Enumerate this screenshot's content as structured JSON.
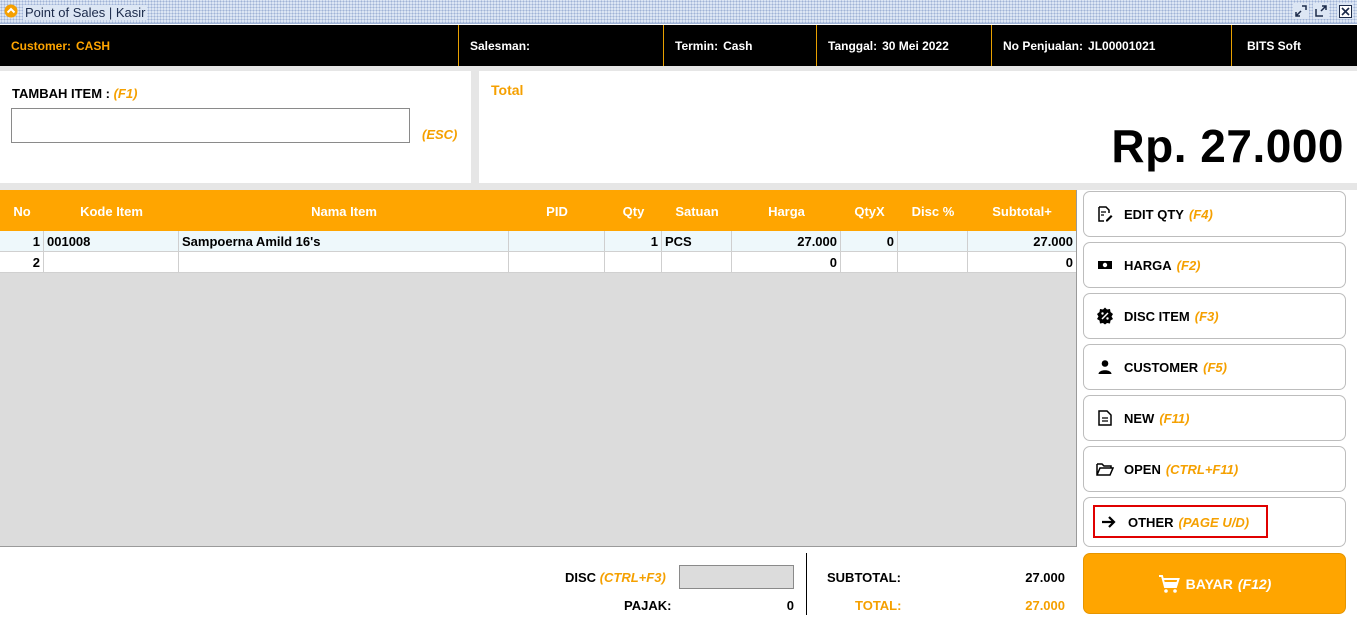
{
  "window": {
    "title": "Point of Sales | Kasir",
    "icons": [
      "app-logo-icon",
      "restore-icon",
      "maximize-icon",
      "close-icon"
    ]
  },
  "info": {
    "customer_label": "Customer:",
    "customer_value": "CASH",
    "salesman_label": "Salesman:",
    "salesman_value": "",
    "termin_label": "Termin:",
    "termin_value": "Cash",
    "tanggal_label": "Tanggal:",
    "tanggal_value": "30 Mei 2022",
    "no_label": "No Penjualan:",
    "no_value": "JL00001021",
    "brand": "BITS Soft"
  },
  "add_item": {
    "label": "TAMBAH ITEM :",
    "shortcut": "(F1)",
    "value": "",
    "esc": "(ESC)"
  },
  "total": {
    "label": "Total",
    "amount": "Rp. 27.000"
  },
  "table": {
    "columns": [
      "No",
      "Kode Item",
      "Nama Item",
      "PID",
      "Qty",
      "Satuan",
      "Harga",
      "QtyX",
      "Disc %",
      "Subtotal+"
    ],
    "rows": [
      {
        "no": "1",
        "kode": "001008",
        "nama": "Sampoerna Amild 16's",
        "pid": "",
        "qty": "1",
        "satuan": "PCS",
        "harga": "27.000",
        "qtyx": "0",
        "disc": "",
        "subtotal": "27.000"
      },
      {
        "no": "2",
        "kode": "",
        "nama": "",
        "pid": "",
        "qty": "",
        "satuan": "",
        "harga": "0",
        "qtyx": "",
        "disc": "",
        "subtotal": "0"
      }
    ]
  },
  "actions": [
    {
      "label": "EDIT QTY",
      "key": "(F4)",
      "icon": "edit-icon"
    },
    {
      "label": "HARGA",
      "key": "(F2)",
      "icon": "money-icon"
    },
    {
      "label": "DISC ITEM",
      "key": "(F3)",
      "icon": "discount-badge-icon"
    },
    {
      "label": "CUSTOMER",
      "key": "(F5)",
      "icon": "person-icon"
    },
    {
      "label": "NEW",
      "key": "(F11)",
      "icon": "document-icon"
    },
    {
      "label": "OPEN",
      "key": "(CTRL+F11)",
      "icon": "folder-open-icon"
    },
    {
      "label": "OTHER",
      "key": "(PAGE U/D)",
      "icon": "arrow-right-icon"
    }
  ],
  "footer": {
    "disc_label": "DISC",
    "disc_key": "(CTRL+F3)",
    "disc_value": "",
    "pajak_label": "PAJAK:",
    "pajak_value": "0",
    "subtotal_label": "SUBTOTAL:",
    "subtotal_value": "27.000",
    "total_label": "TOTAL:",
    "total_value": "27.000",
    "bayar_label": "BAYAR",
    "bayar_key": "(F12)",
    "bayar_icon": "cart-icon"
  },
  "colors": {
    "accent": "#ffa500",
    "header_bg": "#000000",
    "focus": "#e00000"
  }
}
